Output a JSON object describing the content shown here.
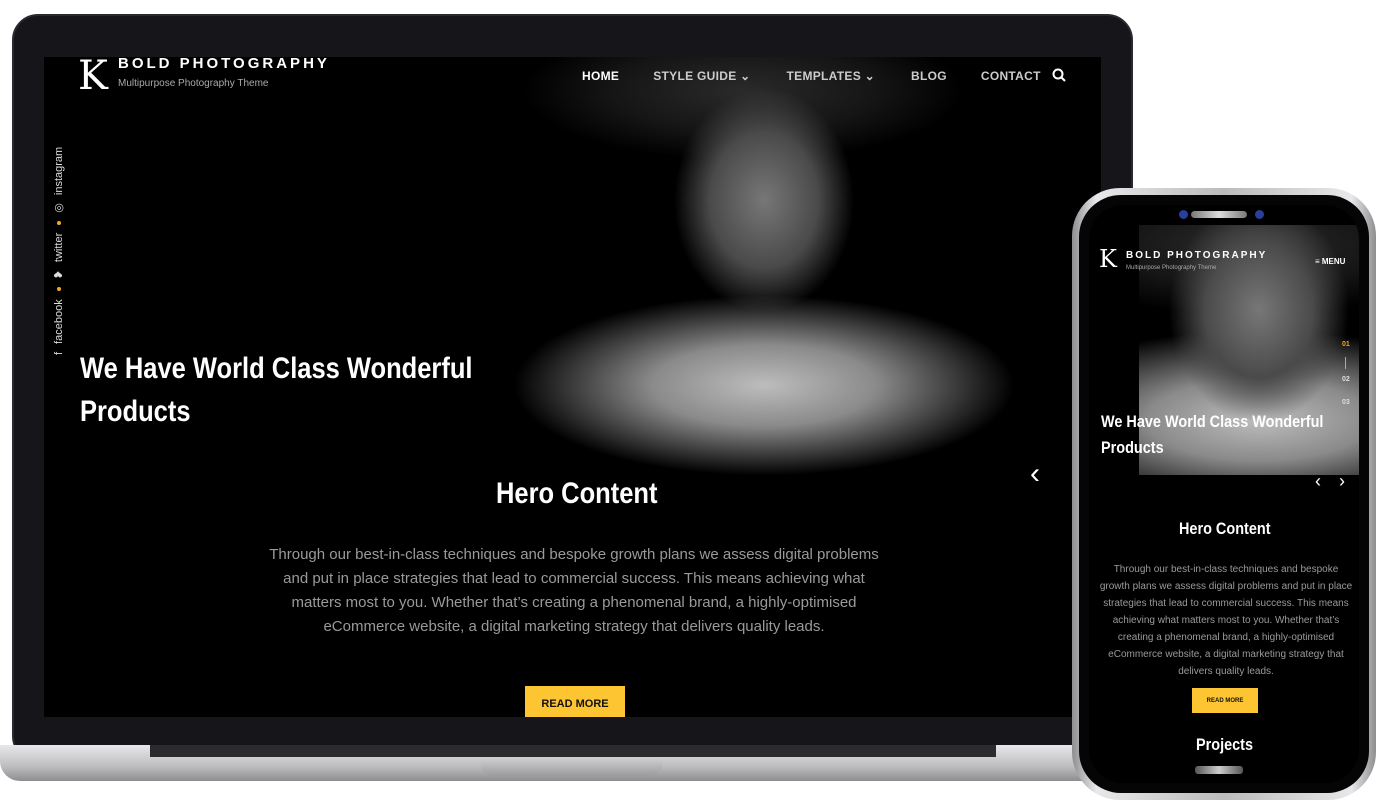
{
  "site": {
    "brand": "BOLD PHOTOGRAPHY",
    "tagline": "Multipurpose Photography Theme",
    "logo_letter": "K"
  },
  "nav": {
    "items": [
      {
        "label": "HOME",
        "active": true
      },
      {
        "label": "STYLE GUIDE ⌄"
      },
      {
        "label": "TEMPLATES ⌄"
      },
      {
        "label": "BLOG"
      },
      {
        "label": "CONTACT"
      }
    ],
    "search_icon": "search-icon"
  },
  "social": {
    "items": [
      "facebook",
      "twitter",
      "instagram"
    ],
    "dot_color": "#f5a623"
  },
  "hero": {
    "title_line1": "We Have World Class Wonderful",
    "title_line2": "Products",
    "prev": "‹",
    "next": "›"
  },
  "content": {
    "heading": "Hero Content",
    "body": "Through our best-in-class techniques and bespoke growth plans we assess digital problems and put in place strategies that lead to commercial success. This means achieving what matters most to you. Whether that’s creating a phenomenal brand, a highly-optimised eCommerce website, a digital marketing strategy that delivers quality leads.",
    "button": "READ MORE",
    "accent": "#fcc531"
  },
  "phone": {
    "menu": "MENU",
    "slides": [
      "01",
      "02",
      "03"
    ],
    "projects": "Projects"
  }
}
